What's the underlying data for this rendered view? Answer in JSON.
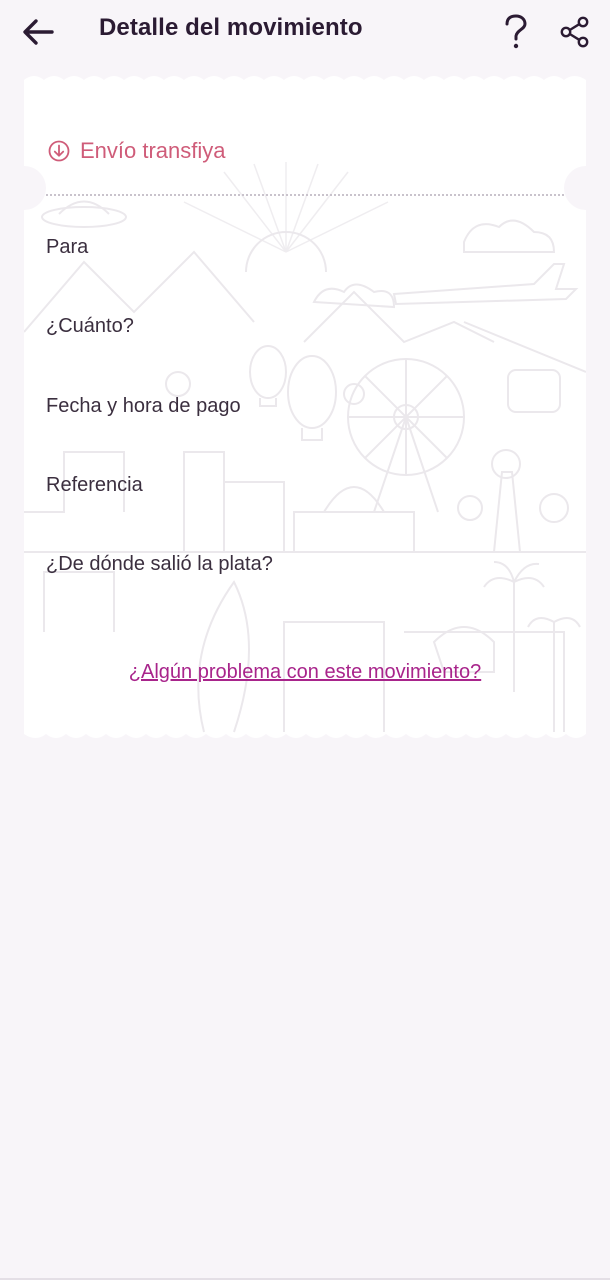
{
  "header": {
    "title": "Detalle del movimiento",
    "back_icon": "arrow-left-icon",
    "help_icon": "question-mark-icon",
    "share_icon": "share-icon"
  },
  "ticket": {
    "transaction_type": "Envío transfiya",
    "transaction_icon": "arrow-down-circle-icon",
    "fields": [
      "Para",
      "¿Cuánto?",
      "Fecha y hora de pago",
      "Referencia",
      "¿De dónde salió la plata?"
    ],
    "problem_link": "¿Algún problema con este movimiento?"
  },
  "colors": {
    "background": "#f8f5f9",
    "accent": "#cf5c79",
    "link": "#a8248b",
    "title": "#2b1b33"
  }
}
